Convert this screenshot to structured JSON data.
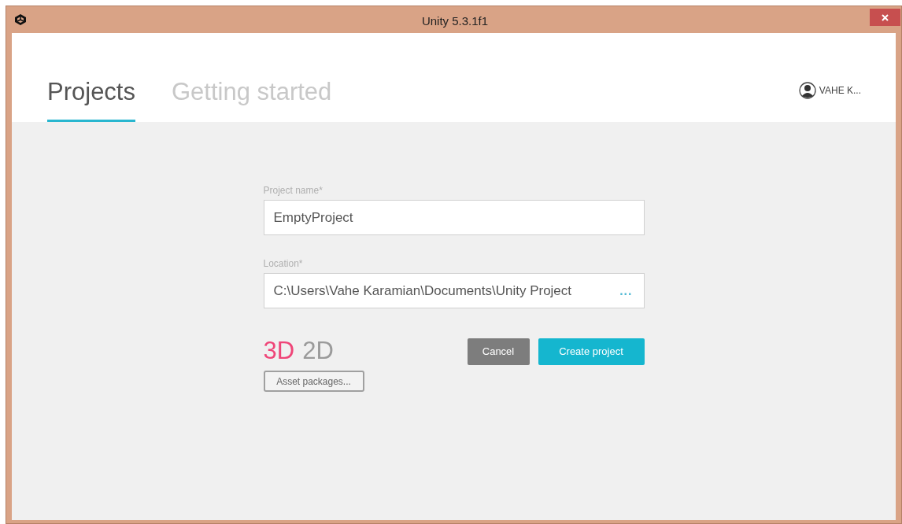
{
  "window": {
    "title": "Unity 5.3.1f1"
  },
  "tabs": [
    {
      "label": "Projects",
      "selected": true
    },
    {
      "label": "Getting started",
      "selected": false
    }
  ],
  "account": {
    "name": "VAHE K..."
  },
  "form": {
    "fields": [
      {
        "label": "Project name*",
        "value": "EmptyProject"
      },
      {
        "label": "Location*",
        "value": "C:\\Users\\Vahe Karamian\\Documents\\Unity Project",
        "browse": "..."
      }
    ],
    "modes": [
      {
        "label": "3D",
        "selected": true
      },
      {
        "label": "2D",
        "selected": false
      }
    ],
    "asset_button": "Asset packages...",
    "cancel_button": "Cancel",
    "create_button": "Create project"
  }
}
